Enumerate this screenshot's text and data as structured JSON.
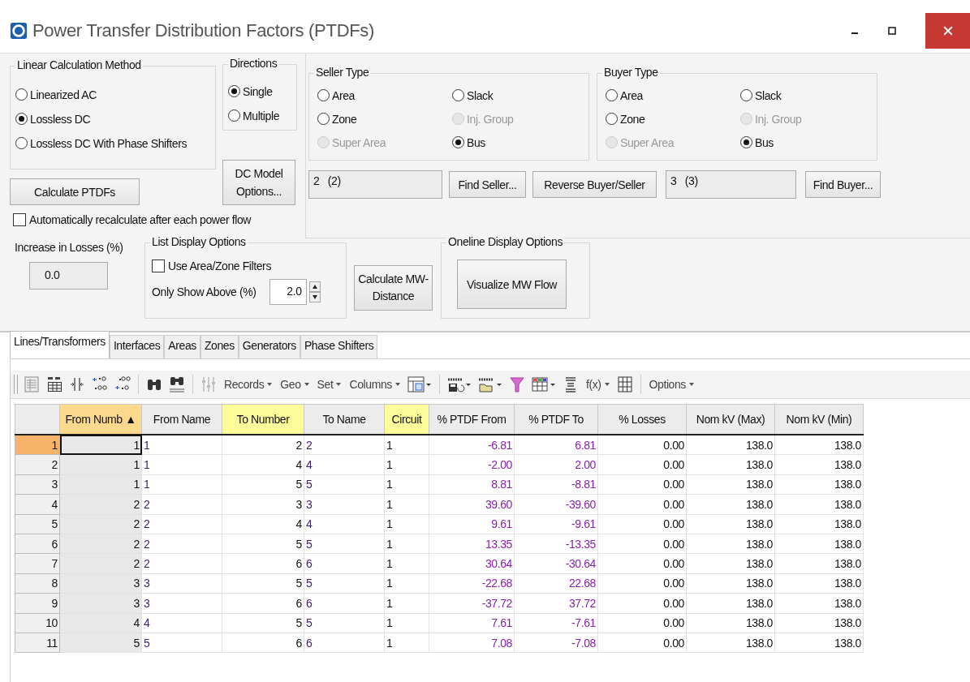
{
  "window": {
    "title": "Power Transfer Distribution Factors (PTDFs)"
  },
  "calc_method": {
    "title": "Linear Calculation Method",
    "options": [
      {
        "label": "Linearized AC",
        "selected": false
      },
      {
        "label": "Lossless DC",
        "selected": true
      },
      {
        "label": "Lossless DC With Phase Shifters",
        "selected": false
      }
    ]
  },
  "directions": {
    "title": "Directions",
    "options": [
      {
        "label": "Single",
        "selected": true
      },
      {
        "label": "Multiple",
        "selected": false
      }
    ]
  },
  "calculate_button": "Calculate PTDFs",
  "dc_model_button": "DC Model Options...",
  "auto_recalc": {
    "label": "Automatically recalculate after each power flow",
    "checked": false
  },
  "seller_type": {
    "title": "Seller Type",
    "options": [
      {
        "label": "Area",
        "selected": false,
        "disabled": false
      },
      {
        "label": "Zone",
        "selected": false,
        "disabled": false
      },
      {
        "label": "Super Area",
        "selected": false,
        "disabled": true
      },
      {
        "label": "Slack",
        "selected": false,
        "disabled": false
      },
      {
        "label": "Inj. Group",
        "selected": false,
        "disabled": true
      },
      {
        "label": "Bus",
        "selected": true,
        "disabled": false
      }
    ]
  },
  "buyer_type": {
    "title": "Buyer Type",
    "options": [
      {
        "label": "Area",
        "selected": false,
        "disabled": false
      },
      {
        "label": "Zone",
        "selected": false,
        "disabled": false
      },
      {
        "label": "Super Area",
        "selected": false,
        "disabled": true
      },
      {
        "label": "Slack",
        "selected": false,
        "disabled": false
      },
      {
        "label": "Inj. Group",
        "selected": false,
        "disabled": true
      },
      {
        "label": "Bus",
        "selected": true,
        "disabled": false
      }
    ]
  },
  "seller_field": "2   (2)",
  "find_seller_button": "Find Seller...",
  "reverse_button": "Reverse Buyer/Seller",
  "buyer_field": "3   (3)",
  "find_buyer_button": "Find Buyer...",
  "losses": {
    "label": "Increase in Losses (%)",
    "value": "0.0"
  },
  "list_display": {
    "title": "List Display Options",
    "filters": {
      "label": "Use Area/Zone Filters",
      "checked": false
    },
    "show_above": {
      "label": "Only Show Above (%)",
      "value": "2.0"
    }
  },
  "mw_distance_button": "Calculate MW-Distance",
  "oneline": {
    "title": "Oneline Display Options",
    "button": "Visualize MW Flow"
  },
  "tabs": [
    {
      "label": "Lines/Transformers",
      "selected": true
    },
    {
      "label": "Interfaces",
      "selected": false
    },
    {
      "label": "Areas",
      "selected": false
    },
    {
      "label": "Zones",
      "selected": false
    },
    {
      "label": "Generators",
      "selected": false
    },
    {
      "label": "Phase Shifters",
      "selected": false
    }
  ],
  "toolbar": [
    {
      "kind": "grip"
    },
    {
      "kind": "icon"
    },
    {
      "kind": "icon"
    },
    {
      "kind": "icon"
    },
    {
      "kind": "icon"
    },
    {
      "kind": "icon"
    },
    {
      "kind": "separator"
    },
    {
      "kind": "icon"
    },
    {
      "kind": "icon"
    },
    {
      "kind": "separator"
    },
    {
      "kind": "icon"
    },
    {
      "kind": "menu",
      "label": "Records"
    },
    {
      "kind": "menu",
      "label": "Geo"
    },
    {
      "kind": "menu",
      "label": "Set"
    },
    {
      "kind": "menu",
      "label": "Columns"
    },
    {
      "kind": "icon"
    },
    {
      "kind": "separator"
    },
    {
      "kind": "icon"
    },
    {
      "kind": "icon"
    },
    {
      "kind": "icon"
    },
    {
      "kind": "icon"
    },
    {
      "kind": "icon"
    },
    {
      "kind": "menu",
      "label": "f(x)"
    },
    {
      "kind": "icon"
    },
    {
      "kind": "separator"
    },
    {
      "kind": "menu",
      "label": "Options"
    }
  ],
  "table": {
    "columns": [
      {
        "label": "From Numb",
        "sorted": true,
        "key": false,
        "sort_mark": "▲"
      },
      {
        "label": "From Name",
        "sorted": false,
        "key": false
      },
      {
        "label": "To Number",
        "sorted": false,
        "key": true
      },
      {
        "label": "To Name",
        "sorted": false,
        "key": false
      },
      {
        "label": "Circuit",
        "sorted": false,
        "key": true
      },
      {
        "label": "% PTDF From",
        "sorted": false,
        "key": false
      },
      {
        "label": "% PTDF To",
        "sorted": false,
        "key": false
      },
      {
        "label": "% Losses",
        "sorted": false,
        "key": false
      },
      {
        "label": "Nom kV (Max)",
        "sorted": false,
        "key": false
      },
      {
        "label": "Nom kV (Min)",
        "sorted": false,
        "key": false
      }
    ],
    "rows": [
      {
        "number": "1",
        "selected": true,
        "cells": [
          "1",
          "1",
          "2",
          "2",
          "1",
          "-6.81",
          "6.81",
          "0.00",
          "138.0",
          "138.0"
        ]
      },
      {
        "number": "2",
        "selected": false,
        "cells": [
          "1",
          "1",
          "4",
          "4",
          "1",
          "-2.00",
          "2.00",
          "0.00",
          "138.0",
          "138.0"
        ]
      },
      {
        "number": "3",
        "selected": false,
        "cells": [
          "1",
          "1",
          "5",
          "5",
          "1",
          "8.81",
          "-8.81",
          "0.00",
          "138.0",
          "138.0"
        ]
      },
      {
        "number": "4",
        "selected": false,
        "cells": [
          "2",
          "2",
          "3",
          "3",
          "1",
          "39.60",
          "-39.60",
          "0.00",
          "138.0",
          "138.0"
        ]
      },
      {
        "number": "5",
        "selected": false,
        "cells": [
          "2",
          "2",
          "4",
          "4",
          "1",
          "9.61",
          "-9.61",
          "0.00",
          "138.0",
          "138.0"
        ]
      },
      {
        "number": "6",
        "selected": false,
        "cells": [
          "2",
          "2",
          "5",
          "5",
          "1",
          "13.35",
          "-13.35",
          "0.00",
          "138.0",
          "138.0"
        ]
      },
      {
        "number": "7",
        "selected": false,
        "cells": [
          "2",
          "2",
          "6",
          "6",
          "1",
          "30.64",
          "-30.64",
          "0.00",
          "138.0",
          "138.0"
        ]
      },
      {
        "number": "8",
        "selected": false,
        "cells": [
          "3",
          "3",
          "5",
          "5",
          "1",
          "-22.68",
          "22.68",
          "0.00",
          "138.0",
          "138.0"
        ]
      },
      {
        "number": "9",
        "selected": false,
        "cells": [
          "3",
          "3",
          "6",
          "6",
          "1",
          "-37.72",
          "37.72",
          "0.00",
          "138.0",
          "138.0"
        ]
      },
      {
        "number": "10",
        "selected": false,
        "cells": [
          "4",
          "4",
          "5",
          "5",
          "1",
          "7.61",
          "-7.61",
          "0.00",
          "138.0",
          "138.0"
        ]
      },
      {
        "number": "11",
        "selected": false,
        "cells": [
          "5",
          "5",
          "6",
          "6",
          "1",
          "7.08",
          "-7.08",
          "0.00",
          "138.0",
          "138.0"
        ]
      }
    ]
  }
}
